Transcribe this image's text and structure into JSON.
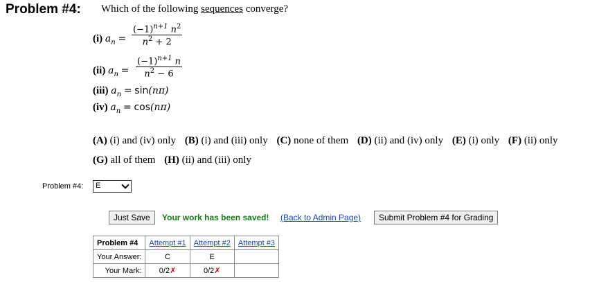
{
  "heading": "Problem #4:",
  "question": {
    "before": "Which of the following",
    "underlined": "sequences",
    "after": "converge?"
  },
  "items": [
    {
      "label": "(i)",
      "var": "a",
      "sub": "n",
      "eq": "=",
      "num": "(−1)",
      "num_exp": "n+1",
      "num_tail": "n",
      "num_tail_exp": "2",
      "den": "n",
      "den_exp": "2",
      "den_tail": "+ 2"
    },
    {
      "label": "(ii)",
      "var": "a",
      "sub": "n",
      "eq": "=",
      "num": "(−1)",
      "num_exp": "n+1",
      "num_tail": "n",
      "den": "n",
      "den_exp": "2",
      "den_tail": "− 6"
    },
    {
      "label": "(iii)",
      "var": "a",
      "sub": "n",
      "eq": "=",
      "fn": "sin",
      "arg": "(nπ)"
    },
    {
      "label": "(iv)",
      "var": "a",
      "sub": "n",
      "eq": "=",
      "fn": "cos",
      "arg": "(nπ)"
    }
  ],
  "choices_line1": [
    {
      "letter": "(A)",
      "text": "(i) and (iv) only"
    },
    {
      "letter": "(B)",
      "text": "(i) and (iii) only"
    },
    {
      "letter": "(C)",
      "text": "none of them"
    },
    {
      "letter": "(D)",
      "text": "(ii) and (iv) only"
    },
    {
      "letter": "(E)",
      "text": "(i) only"
    },
    {
      "letter": "(F)",
      "text": "(ii) only"
    }
  ],
  "choices_line2": [
    {
      "letter": "(G)",
      "text": "all of them"
    },
    {
      "letter": "(H)",
      "text": "(ii) and (iii) only"
    }
  ],
  "answer": {
    "label": "Problem #4:",
    "selected": "E"
  },
  "actions": {
    "save_label": "Just Save",
    "saved_message": "Your work has been saved!",
    "back_link": "(Back to Admin Page)",
    "submit_label": "Submit Problem #4 for Grading"
  },
  "attempts": {
    "header": [
      "Problem #4",
      "Attempt #1",
      "Attempt #2",
      "Attempt #3"
    ],
    "answer_label": "Your Answer:",
    "answers": [
      "C",
      "E",
      ""
    ],
    "mark_label": "Your Mark:",
    "marks": [
      "0/2",
      "0/2",
      ""
    ],
    "wrong_mark": "✗"
  }
}
